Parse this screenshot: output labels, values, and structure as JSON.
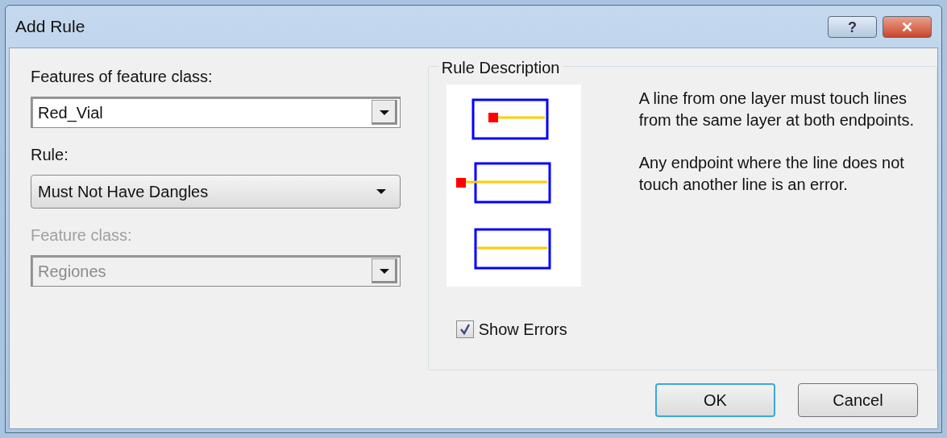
{
  "window": {
    "title": "Add Rule",
    "title_buttons": [
      {
        "kind": "help",
        "label": "?"
      },
      {
        "kind": "close",
        "label": "✕"
      }
    ]
  },
  "fields": [
    {
      "label": "Features of feature class:",
      "kind": "combo",
      "value": "Red_Vial",
      "disabled": false
    },
    {
      "label": "Rule:",
      "kind": "list",
      "value": "Must Not Have Dangles",
      "disabled": false
    },
    {
      "label": "Feature class:",
      "kind": "combo",
      "value": "Regiones",
      "disabled": true
    }
  ],
  "rule_description": {
    "title": "Rule Description",
    "paragraphs": [
      "A line from one layer must touch lines from the same layer at both endpoints.",
      "Any endpoint where the line does not touch another line is an error."
    ],
    "show_errors": {
      "label": "Show Errors",
      "checked": true
    }
  },
  "buttons": [
    {
      "label": "OK",
      "default": true
    },
    {
      "label": "Cancel",
      "default": false
    }
  ]
}
